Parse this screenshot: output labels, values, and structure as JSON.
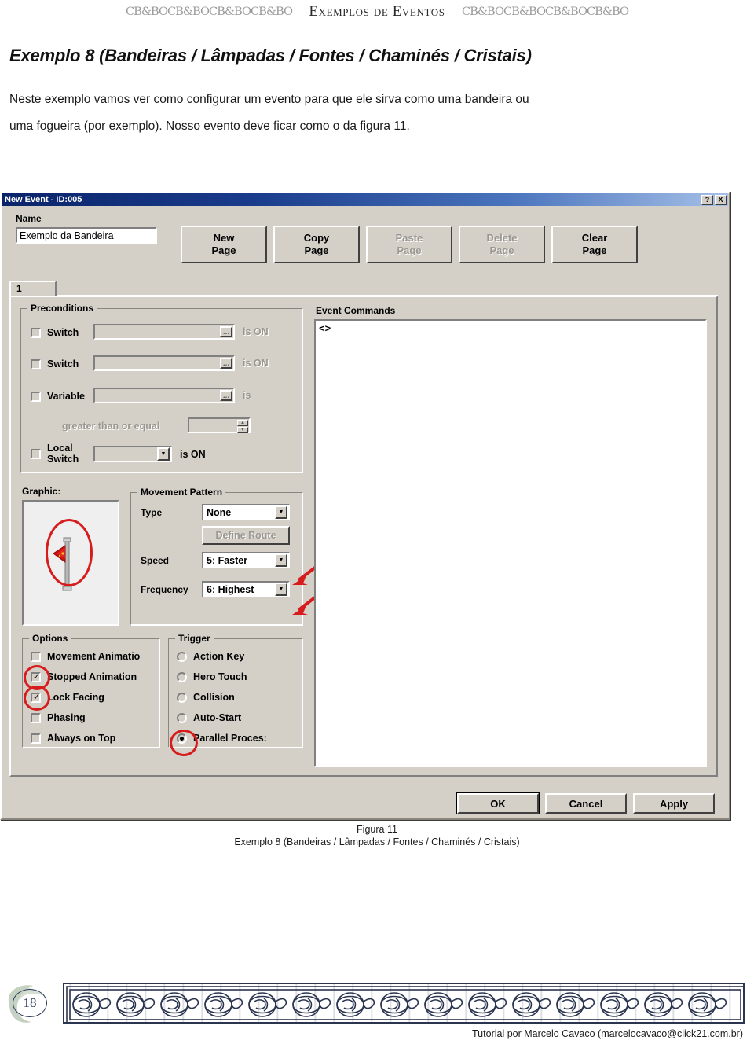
{
  "page_header": {
    "ornament_left": "CB&BOCB&BOCB&BOCB&BO",
    "title": "Exemplos de Eventos",
    "ornament_right": "CB&BOCB&BOCB&BOCB&BO"
  },
  "document": {
    "heading": "Exemplo 8 (Bandeiras / Lâmpadas / Fontes / Chaminés / Cristais)",
    "paragraph_line1": "Neste exemplo vamos ver como configurar um evento para que ele sirva como uma bandeira ou",
    "paragraph_line2": "uma fogueira (por exemplo). Nosso evento deve ficar como o da figura 11."
  },
  "dialog": {
    "title": "New Event - ID:005",
    "help_button": "?",
    "close_button": "X",
    "name_label": "Name",
    "name_value": "Exemplo da Bandeira",
    "page_buttons": [
      {
        "line1": "New",
        "line2": "Page",
        "enabled": true
      },
      {
        "line1": "Copy",
        "line2": "Page",
        "enabled": true
      },
      {
        "line1": "Paste",
        "line2": "Page",
        "enabled": false
      },
      {
        "line1": "Delete",
        "line2": "Page",
        "enabled": false
      },
      {
        "line1": "Clear",
        "line2": "Page",
        "enabled": true
      }
    ],
    "tabs": [
      {
        "label": "1",
        "active": true
      }
    ],
    "preconditions": {
      "title": "Preconditions",
      "rows": [
        {
          "label": "Switch",
          "checked": false,
          "value": "",
          "suffix": "is ON"
        },
        {
          "label": "Switch",
          "checked": false,
          "value": "",
          "suffix": "is ON"
        },
        {
          "label": "Variable",
          "checked": false,
          "value": "",
          "suffix": "is"
        },
        {
          "label": "Local Switch",
          "checked": false,
          "value": "",
          "suffix": "is ON"
        }
      ],
      "comparison_label": "greater than or equal",
      "comparison_value": ""
    },
    "graphic": {
      "label": "Graphic:",
      "sprite_name": "red-flag-sprite"
    },
    "movement_pattern": {
      "title": "Movement Pattern",
      "type_label": "Type",
      "type_value": "None",
      "define_route_label": "Define Route",
      "define_route_enabled": false,
      "speed_label": "Speed",
      "speed_value": "5: Faster",
      "frequency_label": "Frequency",
      "frequency_value": "6: Highest"
    },
    "options": {
      "title": "Options",
      "items": [
        {
          "label": "Movement Animatio",
          "checked": false,
          "highlighted": false
        },
        {
          "label": "Stopped Animation",
          "checked": true,
          "highlighted": true
        },
        {
          "label": "Lock Facing",
          "checked": true,
          "highlighted": true
        },
        {
          "label": "Phasing",
          "checked": false,
          "highlighted": false
        },
        {
          "label": "Always on Top",
          "checked": false,
          "highlighted": false
        }
      ]
    },
    "trigger": {
      "title": "Trigger",
      "items": [
        {
          "label": "Action Key",
          "selected": false,
          "highlighted": false
        },
        {
          "label": "Hero Touch",
          "selected": false,
          "highlighted": false
        },
        {
          "label": "Collision",
          "selected": false,
          "highlighted": false
        },
        {
          "label": "Auto-Start",
          "selected": false,
          "highlighted": false
        },
        {
          "label": "Parallel Proces:",
          "selected": true,
          "highlighted": true
        }
      ]
    },
    "event_commands": {
      "title": "Event Commands",
      "lines": [
        "<>"
      ]
    },
    "footer_buttons": [
      {
        "label": "OK",
        "default": true
      },
      {
        "label": "Cancel",
        "default": false
      },
      {
        "label": "Apply",
        "default": false
      }
    ]
  },
  "figure": {
    "caption_line1": "Figura 11",
    "caption_line2": "Exemplo 8 (Bandeiras / Lâmpadas / Fontes / Chaminés / Cristais)"
  },
  "footer": {
    "page_number": "18",
    "credit": "Tutorial por Marcelo Cavaco (marcelocavaco@click21.com.br)"
  },
  "colors": {
    "annotation_red": "#d61c1c",
    "dialog_face": "#d4d0c8",
    "titlebar_start": "#0a246a",
    "titlebar_end": "#a6c0e8"
  }
}
